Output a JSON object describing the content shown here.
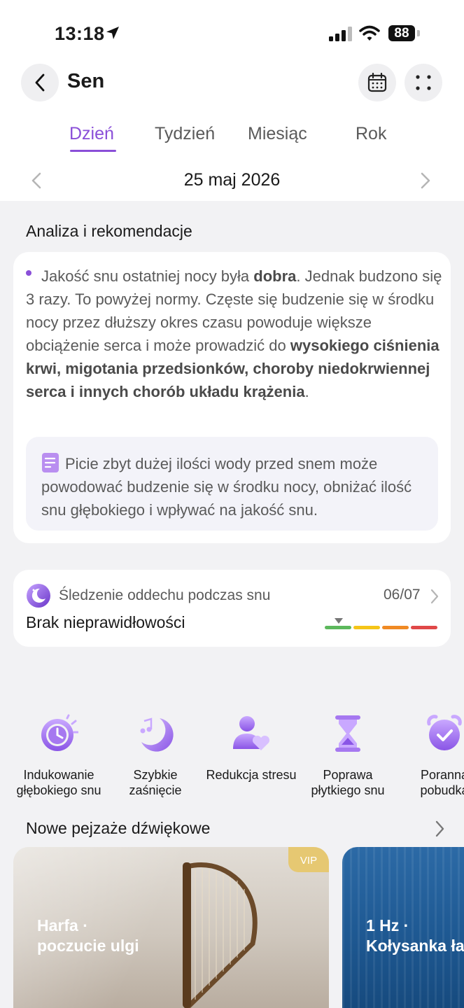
{
  "status_bar": {
    "time": "13:18",
    "battery": "88"
  },
  "header": {
    "title": "Sen"
  },
  "tabs": [
    {
      "label": "Dzień",
      "active": true
    },
    {
      "label": "Tydzień",
      "active": false
    },
    {
      "label": "Miesiąc",
      "active": false
    },
    {
      "label": "Rok",
      "active": false
    }
  ],
  "date": {
    "label": "25 maj 2026"
  },
  "analysis": {
    "title": "Analiza i rekomendacje",
    "p1": "Jakość snu ostatniej nocy była ",
    "quality": "dobra",
    "p2": ". Jednak budzono się 3 razy. To powyżej normy. Częste się budzenie się w środku nocy przez dłuższy okres czasu powoduje większe obciążenie serca i może prowadzić do ",
    "risks": "wysokiego ciśnienia krwi, migotania przedsionków, choroby niedokrwiennej serca i innych chorób układu krążenia",
    "p3": ".",
    "tip": "Picie zbyt dużej ilości wody przed snem może powodować budzenie się w środku nocy, obniżać ilość snu głębokiego i wpływać na jakość snu."
  },
  "breathing": {
    "label": "Śledzenie oddechu podczas snu",
    "date": "06/07",
    "status": "Brak nieprawidłowości",
    "scale_colors": [
      "#5cb85c",
      "#f5c518",
      "#f08a24",
      "#e04848"
    ]
  },
  "functions": [
    {
      "label": "Indukowanie\ngłębokiego snu",
      "icon": "deep-sleep-clock-icon"
    },
    {
      "label": "Szybkie\nzaśnięcie",
      "icon": "moon-music-icon"
    },
    {
      "label": "Redukcja stresu",
      "icon": "person-heart-icon"
    },
    {
      "label": "Poprawa\npłytkiego snu",
      "icon": "hourglass-icon"
    },
    {
      "label": "Poranna\npobudka",
      "icon": "alarm-clock-icon"
    }
  ],
  "soundscapes": {
    "title": "Nowe pejzaże dźwiękowe",
    "items": [
      {
        "title_line1": "Harfa ·",
        "title_line2": "poczucie ulgi",
        "badge": "VIP"
      },
      {
        "title_line1": "1 Hz ·",
        "title_line2": "Kołysanka ła"
      }
    ]
  },
  "colors": {
    "accent": "#8a4fd8",
    "background": "#f2f2f4",
    "card": "#ffffff"
  }
}
